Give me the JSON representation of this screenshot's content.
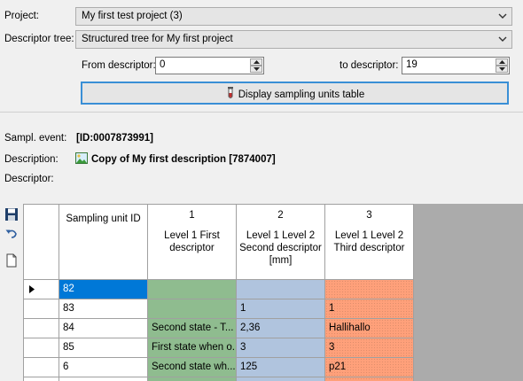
{
  "form": {
    "project_label": "Project:",
    "project_value": "My first test project (3)",
    "tree_label": "Descriptor tree:",
    "tree_value": "Structured tree for My first project",
    "from_label": "From descriptor:",
    "from_value": "0",
    "to_label": "to descriptor:",
    "to_value": "19",
    "display_button": "Display sampling units table"
  },
  "info": {
    "event_label": "Sampl. event:",
    "event_value": "[ID:0007873991]",
    "description_label": "Description:",
    "description_value": "Copy of My first description [7874007]",
    "descriptor_label": "Descriptor:"
  },
  "toolbar": {
    "icons": [
      "save-icon",
      "undo-icon",
      "new-document-icon"
    ]
  },
  "colors": {
    "green": "#8fbc8f",
    "blue": "#b0c4de",
    "orange": "#ffa07a",
    "selection": "#0078d7",
    "button_border": "#3a8fd6"
  },
  "table": {
    "columns": [
      {
        "num": "",
        "name": "Sampling unit ID"
      },
      {
        "num": "1",
        "name": "Level 1 First descriptor"
      },
      {
        "num": "2",
        "name": "Level 1 Level 2 Second descriptor [mm]"
      },
      {
        "num": "3",
        "name": "Level 1 Level 2 Third descriptor"
      }
    ],
    "rows": [
      {
        "id": "82",
        "c1": "",
        "c2": "",
        "c3": "",
        "current": true
      },
      {
        "id": "83",
        "c1": "",
        "c2": "1",
        "c3": "1"
      },
      {
        "id": "84",
        "c1": "Second state - T...",
        "c2": "2,36",
        "c3": "Hallihallo"
      },
      {
        "id": "85",
        "c1": "First state when o...",
        "c2": "3",
        "c3": "3"
      },
      {
        "id": "6",
        "c1": "Second state wh...",
        "c2": "125",
        "c3": "p21"
      }
    ]
  }
}
